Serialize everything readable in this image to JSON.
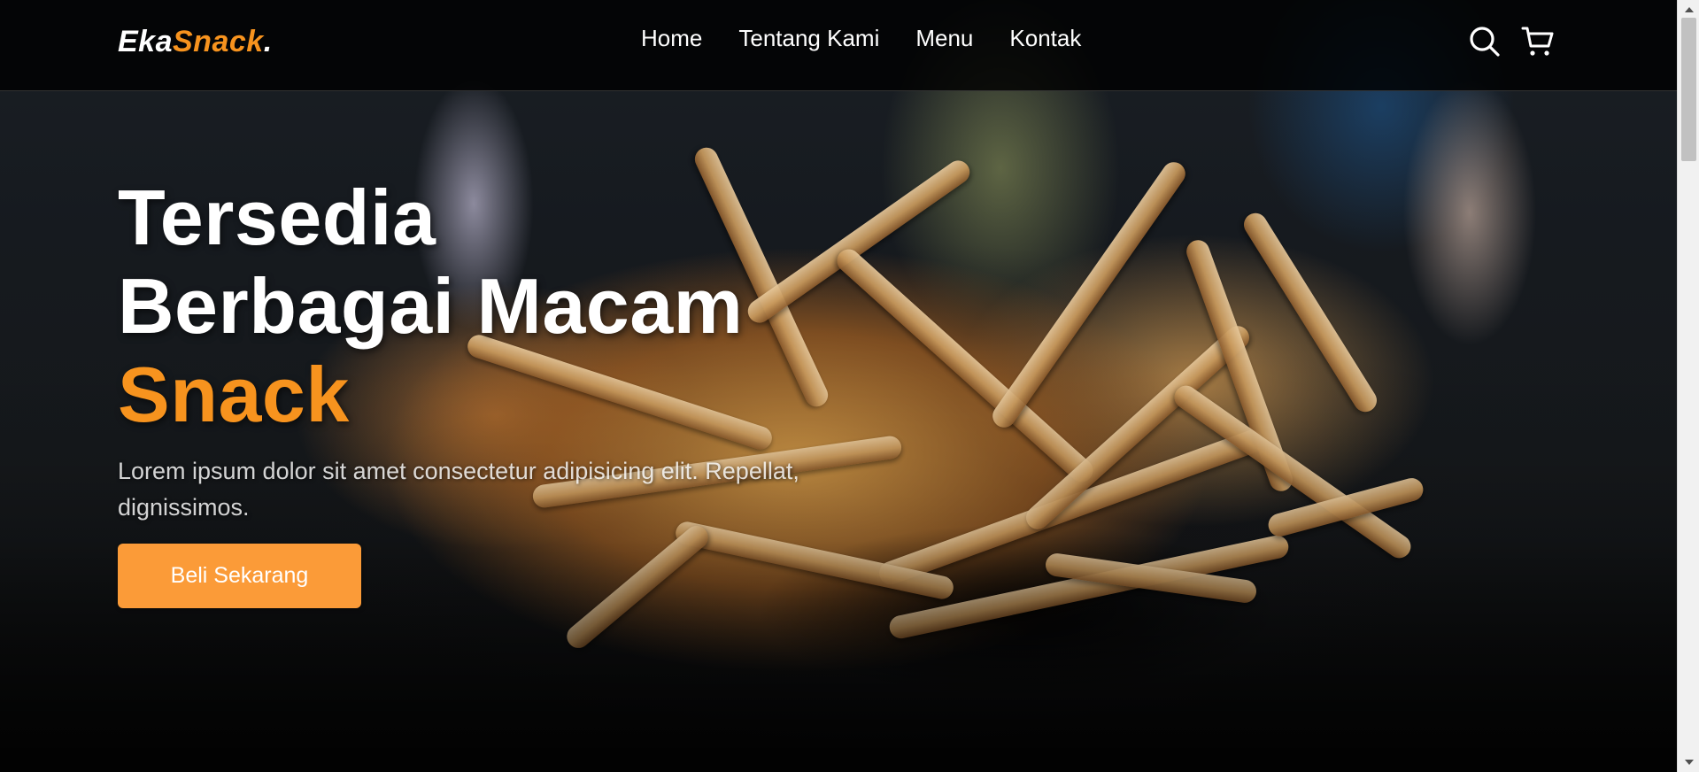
{
  "navbar": {
    "logo": {
      "part1": "Eka",
      "part2": "Snack",
      "part3": "."
    },
    "links": [
      {
        "label": "Home"
      },
      {
        "label": "Tentang Kami"
      },
      {
        "label": "Menu"
      },
      {
        "label": "Kontak"
      }
    ],
    "icons": [
      "search-icon",
      "shopping-cart-icon"
    ]
  },
  "hero": {
    "title_line1": "Tersedia",
    "title_line2": "Berbagai Macam",
    "title_accent": "Snack",
    "description": "Lorem ipsum dolor sit amet consectetur adipisicing elit. Repellat, dignissimos.",
    "cta_label": "Beli Sekarang"
  },
  "colors": {
    "accent": "#f7931e",
    "button": "#fb9b38",
    "navbar_bg": "#000000",
    "text": "#ffffff"
  }
}
